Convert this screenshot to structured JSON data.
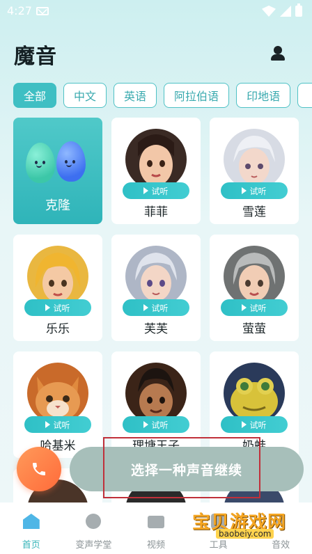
{
  "status_bar": {
    "time": "4:27"
  },
  "header": {
    "title": "魔音"
  },
  "tabs": [
    {
      "label": "全部",
      "active": true
    },
    {
      "label": "中文"
    },
    {
      "label": "英语"
    },
    {
      "label": "阿拉伯语"
    },
    {
      "label": "印地语"
    },
    {
      "label": ""
    }
  ],
  "listen_label": "试听",
  "cards": {
    "clone": {
      "name": "克隆"
    },
    "voices": [
      {
        "name": "菲菲",
        "avatar_icon": "female-cartoon-avatar"
      },
      {
        "name": "雪莲",
        "avatar_icon": "white-hair-anime-avatar"
      },
      {
        "name": "乐乐",
        "avatar_icon": "blonde-girl-avatar"
      },
      {
        "name": "芙芙",
        "avatar_icon": "silver-hair-girl-avatar"
      },
      {
        "name": "萤萤",
        "avatar_icon": "grey-hair-girl-avatar"
      },
      {
        "name": "哈基米",
        "avatar_icon": "orange-cat-avatar"
      },
      {
        "name": "理塘王子",
        "avatar_icon": "cartoon-boy-avatar"
      },
      {
        "name": "奶蛙",
        "avatar_icon": "yellow-frog-avatar"
      }
    ]
  },
  "cta": {
    "label": "选择一种声音继续"
  },
  "bottom_nav": [
    {
      "label": "首页",
      "active": true
    },
    {
      "label": "变声学堂"
    },
    {
      "label": "视频"
    },
    {
      "label": "工具"
    },
    {
      "label": "音效"
    }
  ],
  "watermark": {
    "text": "宝贝游戏网",
    "url": "baobeiy.com"
  },
  "colors": {
    "accent": "#3fbfc3",
    "cta_disabled": "#a7bfba",
    "call": "#ff7a45"
  }
}
